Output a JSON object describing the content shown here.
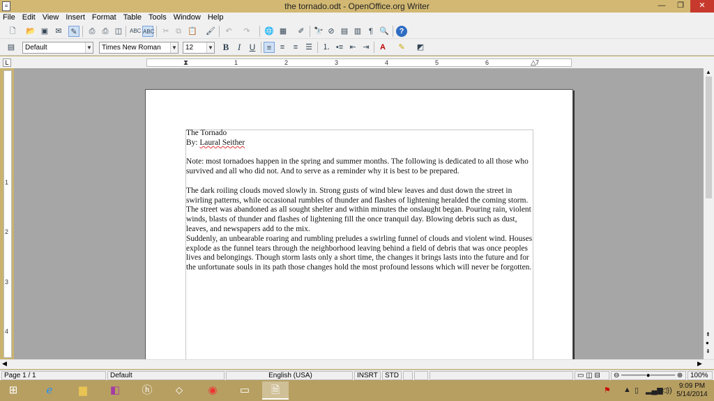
{
  "window": {
    "title": "the tornado.odt - OpenOffice.org Writer"
  },
  "menu": [
    "File",
    "Edit",
    "View",
    "Insert",
    "Format",
    "Table",
    "Tools",
    "Window",
    "Help"
  ],
  "format_bar": {
    "style": "Default",
    "font": "Times New Roman",
    "size": "12"
  },
  "ruler": {
    "h": [
      "1",
      "2",
      "3",
      "4",
      "5",
      "6",
      "7"
    ],
    "v": [
      "1",
      "2",
      "3",
      "4"
    ]
  },
  "document": {
    "title": "The Tornado",
    "byline_prefix": "By: ",
    "author": "Laural Seither",
    "note": "Note: most tornadoes happen in the spring and summer months. The following is dedicated to all those who survived and all who did not. And to serve as a reminder why it is best to be prepared.",
    "para1": "The dark roiling clouds moved slowly in.  Strong gusts of wind blew leaves and dust down the street in swirling patterns, while occasional rumbles of thunder and flashes of lightening heralded the coming storm.",
    "para2": "The street was abandoned as all sought shelter and within minutes the onslaught began. Pouring rain, violent winds, blasts of thunder and flashes of lightening fill the once tranquil day. Blowing debris such as dust, leaves, and newspapers add to the mix.",
    "para3": "Suddenly, an unbearable roaring and rumbling preludes a swirling funnel of clouds and violent wind. Houses explode as the funnel tears through the neighborhood leaving behind a field of debris that was once peoples lives and belongings. Though storm lasts only a short time, the changes it brings lasts into the future and for the unfortunate souls in its path those changes hold the most profound lessons which will never be forgotten."
  },
  "status": {
    "page": "Page 1 / 1",
    "style": "Default",
    "language": "English (USA)",
    "insert_mode": "INSRT",
    "selection_mode": "STD",
    "zoom": "100%"
  },
  "taskbar": {
    "time": "9:09 PM",
    "date": "5/14/2014"
  },
  "colors": {
    "titlebar": "#d2b872",
    "close": "#c7392d",
    "doc_bg": "#a6a6a6",
    "taskbar": "#b79f62"
  }
}
